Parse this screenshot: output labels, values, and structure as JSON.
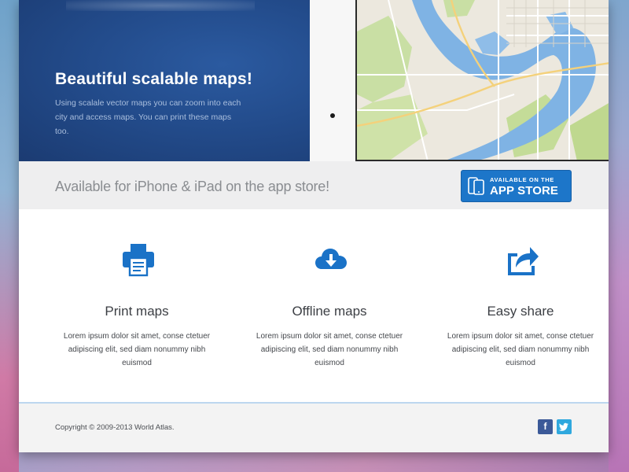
{
  "hero": {
    "title": "Beautiful scalable maps!",
    "text": "Using scalale vector maps you can zoom into each city and access maps. You can print these maps too."
  },
  "store_bar": {
    "text": "Available for iPhone & iPad on the app store!",
    "button_small": "AVAILABLE ON THE",
    "button_big": "APP STORE"
  },
  "features": [
    {
      "icon": "printer-icon",
      "title": "Print maps",
      "text": "Lorem ipsum dolor sit amet, conse ctetuer adipiscing elit, sed diam nonummy nibh euismod"
    },
    {
      "icon": "cloud-download-icon",
      "title": "Offline maps",
      "text": "Lorem ipsum dolor sit amet, conse ctetuer adipiscing elit, sed diam nonummy nibh euismod"
    },
    {
      "icon": "share-icon",
      "title": "Easy share",
      "text": "Lorem ipsum dolor sit amet, conse ctetuer adipiscing elit, sed diam nonummy nibh euismod"
    }
  ],
  "footer": {
    "copyright": "Copyright © 2009-2013 World Atlas.",
    "facebook": "f",
    "twitter": "t"
  },
  "colors": {
    "accent": "#1d76c9",
    "hero_blue": "#234c8c",
    "icon_blue": "#1a72c7"
  }
}
